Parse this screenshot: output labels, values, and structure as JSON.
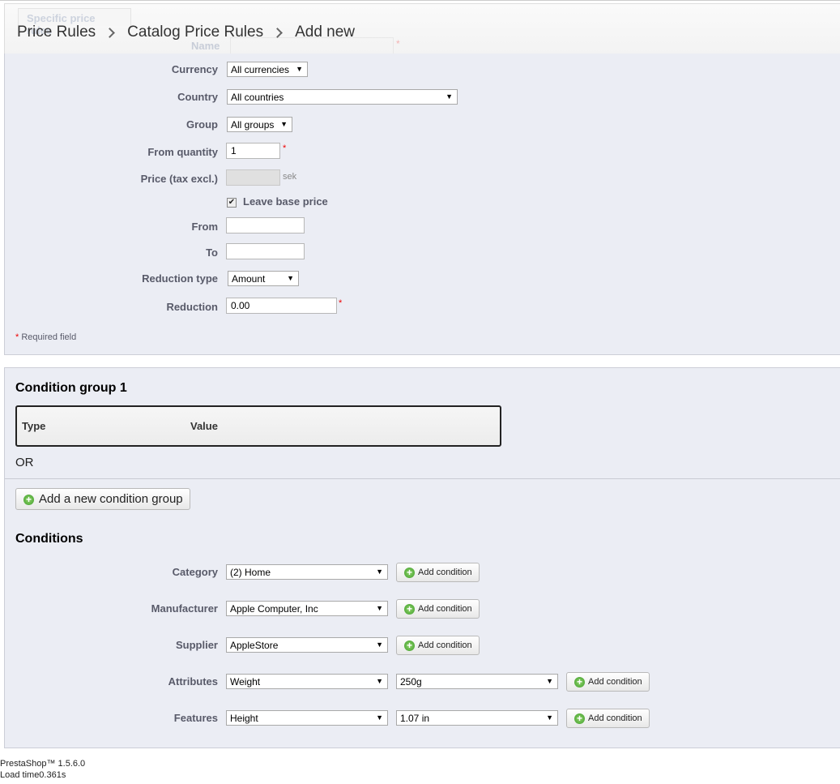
{
  "ghost": {
    "tab": "Specific price rules",
    "name_label": "Name",
    "star": "*"
  },
  "breadcrumb": [
    "Price Rules",
    "Catalog Price Rules",
    "Add new"
  ],
  "form": {
    "currency_label": "Currency",
    "currency_value": "All currencies",
    "country_label": "Country",
    "country_value": "All countries",
    "group_label": "Group",
    "group_value": "All groups",
    "from_quantity_label": "From quantity",
    "from_quantity_value": "1",
    "price_label": "Price (tax excl.)",
    "price_unit": "sek",
    "leave_base_label": "Leave base price",
    "leave_base_checked": "✔",
    "from_label": "From",
    "to_label": "To",
    "reduction_type_label": "Reduction type",
    "reduction_type_value": "Amount",
    "reduction_label": "Reduction",
    "reduction_value": "0.00",
    "required_star": "*",
    "required_text": " Required field"
  },
  "condition_group": {
    "title": "Condition group 1",
    "col_type": "Type",
    "col_value": "Value",
    "or_text": "OR",
    "add_group_button": "Add a new condition group"
  },
  "conditions": {
    "title": "Conditions",
    "add_label": "Add condition",
    "category_label": "Category",
    "category_value": "(2) Home",
    "manufacturer_label": "Manufacturer",
    "manufacturer_value": "Apple Computer, Inc",
    "supplier_label": "Supplier",
    "supplier_value": "AppleStore",
    "attributes_label": "Attributes",
    "attributes_value": "Weight",
    "attributes_value2": "250g",
    "features_label": "Features",
    "features_value": "Height",
    "features_value2": "1.07 in"
  },
  "footer": {
    "version": "PrestaShop™ 1.5.6.0",
    "load_time": "Load time0.361s"
  },
  "icons": {
    "dropdown": "▼",
    "plus": "+"
  }
}
